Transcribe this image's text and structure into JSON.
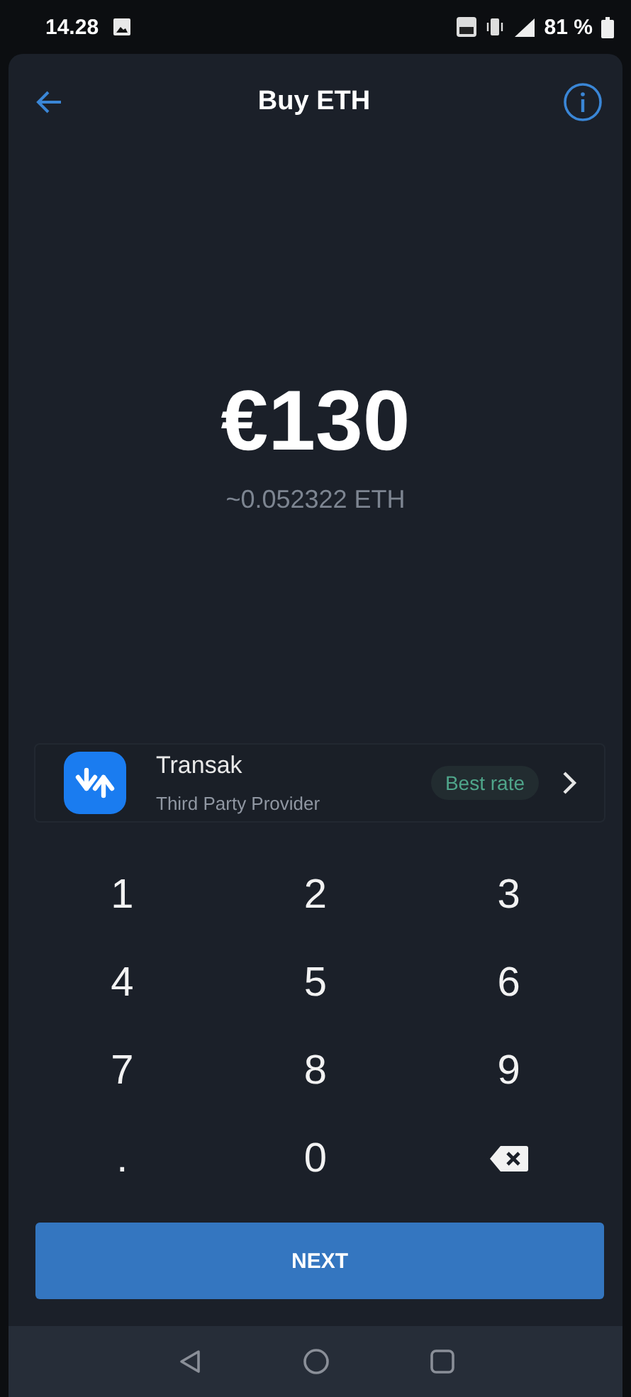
{
  "status_bar": {
    "time": "14.28",
    "battery": "81 %"
  },
  "header": {
    "title": "Buy ETH"
  },
  "amount": {
    "value": "€130",
    "converted": "~0.052322 ETH"
  },
  "provider": {
    "name": "Transak",
    "subtitle": "Third Party Provider",
    "badge": "Best rate"
  },
  "keypad": [
    {
      "kind": "digit",
      "label": "1"
    },
    {
      "kind": "digit",
      "label": "2"
    },
    {
      "kind": "digit",
      "label": "3"
    },
    {
      "kind": "digit",
      "label": "4"
    },
    {
      "kind": "digit",
      "label": "5"
    },
    {
      "kind": "digit",
      "label": "6"
    },
    {
      "kind": "digit",
      "label": "7"
    },
    {
      "kind": "digit",
      "label": "8"
    },
    {
      "kind": "digit",
      "label": "9"
    },
    {
      "kind": "digit",
      "label": "."
    },
    {
      "kind": "digit",
      "label": "0"
    },
    {
      "kind": "backspace"
    }
  ],
  "primary_button": "NEXT"
}
